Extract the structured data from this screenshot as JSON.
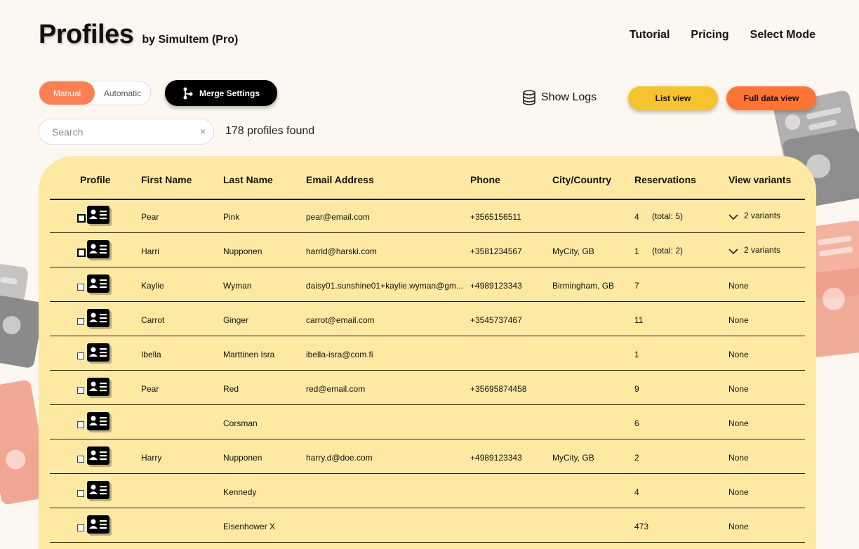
{
  "header": {
    "title": "Profiles",
    "subtitle": "by Simultem (Pro)"
  },
  "nav": {
    "tutorial": "Tutorial",
    "pricing": "Pricing",
    "select_mode": "Select Mode"
  },
  "mode_toggle": {
    "manual": "Manual",
    "automatic": "Automatic",
    "selected": "Manual"
  },
  "merge_settings": {
    "label": "Merge Settings",
    "icon": "branch-icon"
  },
  "show_logs": {
    "label": "Show Logs",
    "icon": "database-icon"
  },
  "views": {
    "list": "List view",
    "full": "Full data view"
  },
  "search": {
    "placeholder": "Search",
    "value": "",
    "clear": "×"
  },
  "results": {
    "count_text": "178 profiles found"
  },
  "colors": {
    "accent_orange": "#ff7f50",
    "list_view": "#f6c32c",
    "full_view": "#ff7433",
    "table_bg": "#fde9a2",
    "page_bg": "#fcf8f1"
  },
  "table": {
    "columns": [
      "Profile",
      "First Name",
      "Last Name",
      "Email Address",
      "Phone",
      "City/Country",
      "Reservations",
      "View variants"
    ],
    "rows": [
      {
        "first": "Pear",
        "last": "Pink",
        "email": "pear@email.com",
        "phone": "+3565156511",
        "city": "",
        "reservations": "4",
        "total": "(total: 5)",
        "variants": "2 variants",
        "expandable": true
      },
      {
        "first": "Harri",
        "last": "Nupponen",
        "email": "harrid@harski.com",
        "phone": "+3581234567",
        "city": "MyCity, GB",
        "reservations": "1",
        "total": "(total: 2)",
        "variants": "2 variants",
        "expandable": true
      },
      {
        "first": "Kaylie",
        "last": "Wyman",
        "email": "daisy01.sunshine01+kaylie.wyman@gm...",
        "phone": "+4989123343",
        "city": "Birmingham, GB",
        "reservations": "7",
        "total": "",
        "variants": "None",
        "expandable": false
      },
      {
        "first": "Carrot",
        "last": "Ginger",
        "email": "carrot@email.com",
        "phone": "+3545737467",
        "city": "",
        "reservations": "11",
        "total": "",
        "variants": "None",
        "expandable": false
      },
      {
        "first": "Ibella",
        "last": "Marttinen Isra",
        "email": "ibella-isra@com.fi",
        "phone": "",
        "city": "",
        "reservations": "1",
        "total": "",
        "variants": "None",
        "expandable": false
      },
      {
        "first": "Pear",
        "last": "Red",
        "email": "red@email.com",
        "phone": "+35695874458",
        "city": "",
        "reservations": "9",
        "total": "",
        "variants": "None",
        "expandable": false
      },
      {
        "first": "",
        "last": "Corsman",
        "email": "",
        "phone": "",
        "city": "",
        "reservations": "6",
        "total": "",
        "variants": "None",
        "expandable": false
      },
      {
        "first": "Harry",
        "last": "Nupponen",
        "email": "harry.d@doe.com",
        "phone": "+4989123343",
        "city": "MyCity, GB",
        "reservations": "2",
        "total": "",
        "variants": "None",
        "expandable": false
      },
      {
        "first": "",
        "last": "Kennedy",
        "email": "",
        "phone": "",
        "city": "",
        "reservations": "4",
        "total": "",
        "variants": "None",
        "expandable": false
      },
      {
        "first": "",
        "last": "Eisenhower X",
        "email": "",
        "phone": "",
        "city": "",
        "reservations": "473",
        "total": "",
        "variants": "None",
        "expandable": false
      }
    ]
  }
}
